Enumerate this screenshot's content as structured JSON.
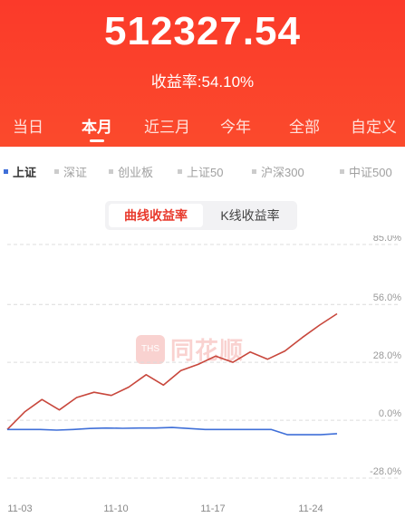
{
  "header": {
    "total_value": "512327.54",
    "rate_text": "收益率:54.10%"
  },
  "tabs": [
    {
      "label": "当日",
      "active": false
    },
    {
      "label": "本月",
      "active": true
    },
    {
      "label": "近三月",
      "active": false
    },
    {
      "label": "今年",
      "active": false
    },
    {
      "label": "全部",
      "active": false
    },
    {
      "label": "自定义",
      "active": false
    }
  ],
  "indices": [
    {
      "label": "上证",
      "active": true
    },
    {
      "label": "深证",
      "active": false
    },
    {
      "label": "创业板",
      "active": false
    },
    {
      "label": "上证50",
      "active": false
    },
    {
      "label": "沪深300",
      "active": false
    },
    {
      "label": "中证500",
      "active": false
    }
  ],
  "toggle": {
    "curve_label": "曲线收益率",
    "kline_label": "K线收益率"
  },
  "watermark": {
    "text": "同花顺"
  },
  "colors": {
    "header_bg": "#fb3a2a",
    "accent": "#e8392c",
    "portfolio_line": "#c8473c",
    "index_line": "#3f6fd8"
  },
  "chart_data": {
    "type": "line",
    "x": [
      "11-03",
      "11-04",
      "11-06",
      "11-07",
      "11-08",
      "11-09",
      "11-10",
      "11-13",
      "11-14",
      "11-15",
      "11-16",
      "11-17",
      "11-20",
      "11-21",
      "11-22",
      "11-23",
      "11-24",
      "11-27"
    ],
    "ylim": [
      -28.0,
      85.0
    ],
    "y_ticks": [
      "85.0%",
      "56.0%",
      "28.0%",
      "0.0%",
      "-28.0%"
    ],
    "y_tick_values": [
      85.0,
      56.0,
      28.0,
      0.0,
      -28.0
    ],
    "x_tick_labels": [
      "11-03",
      "11-10",
      "11-17",
      "11-24"
    ],
    "x_tick_index": [
      0,
      6,
      11,
      16
    ],
    "series": [
      {
        "color": "#c8473c",
        "values": [
          -4.5,
          4.0,
          10.0,
          5.0,
          11.0,
          13.5,
          12.0,
          16.0,
          22.0,
          17.0,
          24.0,
          27.0,
          31.0,
          28.0,
          33.0,
          29.5,
          33.5,
          40.0,
          46.0,
          51.5
        ]
      },
      {
        "color": "#3f6fd8",
        "values": [
          -4.5,
          -4.5,
          -4.5,
          -4.8,
          -4.5,
          -4.0,
          -3.8,
          -3.9,
          -3.8,
          -3.8,
          -3.5,
          -4.0,
          -4.5,
          -4.5,
          -4.5,
          -4.5,
          -4.5,
          -7.0,
          -7.0,
          -7.0,
          -6.5
        ]
      }
    ]
  }
}
